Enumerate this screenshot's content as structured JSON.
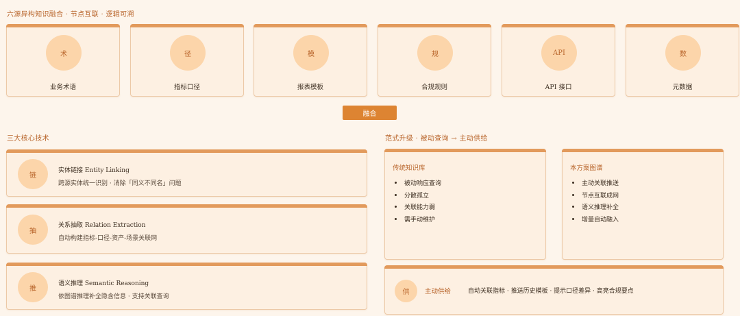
{
  "top_heading": "六源异构知识融合 · 节点互联 · 逻辑可溯",
  "sources": [
    {
      "glyph": "术",
      "label": "业务术语"
    },
    {
      "glyph": "径",
      "label": "指标口径"
    },
    {
      "glyph": "模",
      "label": "报表模板"
    },
    {
      "glyph": "规",
      "label": "合规规则"
    },
    {
      "glyph": "API",
      "label": "API 接口"
    },
    {
      "glyph": "数",
      "label": "元数据"
    }
  ],
  "fuse_label": "融合",
  "tech_heading": "三大核心技术",
  "techs": [
    {
      "glyph": "链",
      "title": "实体链接 Entity Linking",
      "desc": "跨源实体统一识别 · 消除「同义不同名」问题"
    },
    {
      "glyph": "抽",
      "title": "关系抽取 Relation Extraction",
      "desc": "自动构建指标-口径-资产-场景关联网"
    },
    {
      "glyph": "推",
      "title": "语义推理 Semantic Reasoning",
      "desc": "依图谱推理补全隐含信息 · 支持关联查询"
    }
  ],
  "paradigm_heading": "范式升级 · 被动查询 → 主动供给",
  "traditional": {
    "title": "传统知识库",
    "items": [
      "被动响应查询",
      "分散孤立",
      "关联能力弱",
      "需手动维护"
    ]
  },
  "proposed": {
    "title": "本方案图谱",
    "items": [
      "主动关联推送",
      "节点互联成网",
      "语义推理补全",
      "增量自动融入"
    ]
  },
  "supply": {
    "glyph": "供",
    "title": "主动供给",
    "desc": "自动关联指标 · 推送历史模板 · 提示口径差异 · 高亮合规要点"
  },
  "colors": {
    "accent": "#dd8432",
    "accent_text": "#b8642a",
    "card_bg": "#fdf0e2",
    "card_border": "#ecc9a7",
    "circle": "#fcd5aa",
    "page_bg": "#fdf5ec"
  }
}
